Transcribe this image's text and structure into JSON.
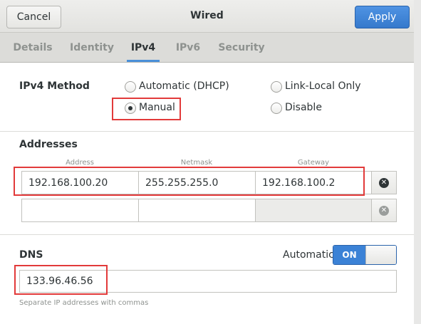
{
  "header": {
    "cancel_label": "Cancel",
    "title": "Wired",
    "apply_label": "Apply"
  },
  "tabs": [
    {
      "label": "Details",
      "active": false
    },
    {
      "label": "Identity",
      "active": false
    },
    {
      "label": "IPv4",
      "active": true
    },
    {
      "label": "IPv6",
      "active": false
    },
    {
      "label": "Security",
      "active": false
    }
  ],
  "ipv4_method": {
    "label": "IPv4 Method",
    "options": [
      {
        "label": "Automatic (DHCP)",
        "checked": false
      },
      {
        "label": "Link-Local Only",
        "checked": false
      },
      {
        "label": "Manual",
        "checked": true
      },
      {
        "label": "Disable",
        "checked": false
      }
    ]
  },
  "addresses": {
    "label": "Addresses",
    "columns": [
      "Address",
      "Netmask",
      "Gateway"
    ],
    "rows": [
      {
        "address": "192.168.100.20",
        "netmask": "255.255.255.0",
        "gateway": "192.168.100.2"
      },
      {
        "address": "",
        "netmask": "",
        "gateway": ""
      }
    ]
  },
  "dns": {
    "label": "DNS",
    "automatic_label": "Automatic",
    "switch_label": "ON",
    "value": "133.96.46.56",
    "hint": "Separate IP addresses with commas"
  },
  "colors": {
    "accent": "#4a90d9",
    "highlight": "#e23a3a"
  }
}
